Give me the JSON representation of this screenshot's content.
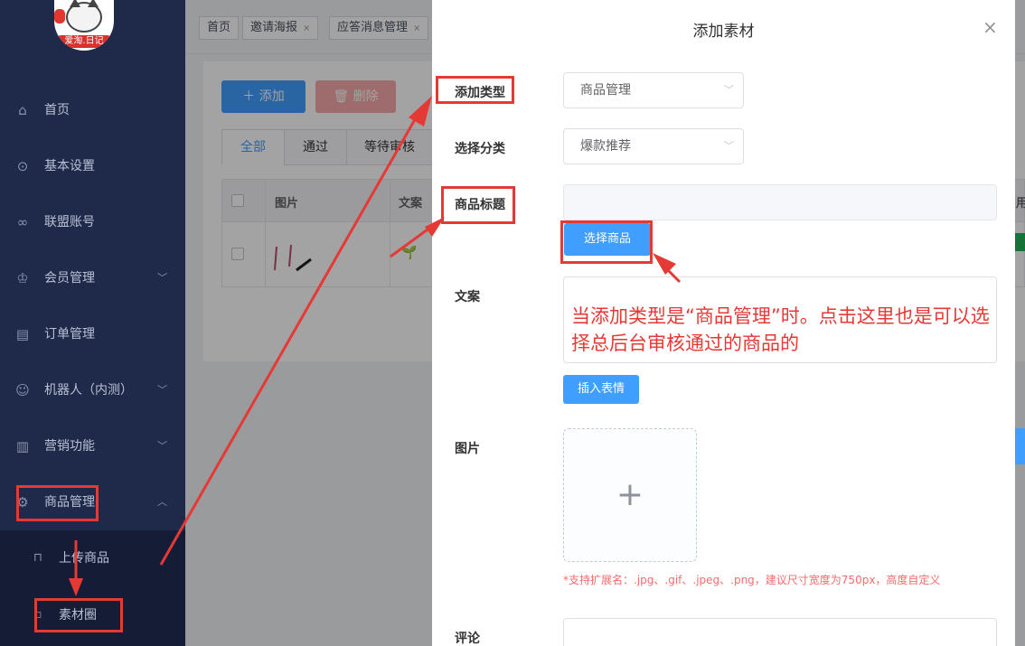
{
  "sidebar": {
    "logo_text": "爱淘.日记",
    "items": [
      {
        "label": "首页",
        "icon": "home-icon"
      },
      {
        "label": "基本设置",
        "icon": "settings-icon"
      },
      {
        "label": "联盟账号",
        "icon": "link-icon"
      },
      {
        "label": "会员管理",
        "icon": "crown-icon"
      },
      {
        "label": "订单管理",
        "icon": "order-icon"
      },
      {
        "label": "机器人（内测）",
        "icon": "robot-icon"
      },
      {
        "label": "营销功能",
        "icon": "bar-chart-icon"
      },
      {
        "label": "商品管理",
        "icon": "goods-icon"
      }
    ],
    "sub_items": [
      {
        "label": "上传商品",
        "icon": "bag-icon"
      },
      {
        "label": "素材圈",
        "icon": "doc-icon"
      }
    ]
  },
  "tabs": [
    "首页",
    "邀请海报",
    "应答消息管理"
  ],
  "content": {
    "add_label": "＋ 添加",
    "delete_label": "删除",
    "filter_tabs": [
      "全部",
      "通过",
      "等待审核"
    ],
    "columns": [
      "图片",
      "文案"
    ],
    "right_col_partial": "用"
  },
  "drawer": {
    "title": "添加素材",
    "close": "×",
    "labels": {
      "type": "添加类型",
      "category": "选择分类",
      "goods_title": "商品标题",
      "copy": "文案",
      "image": "图片",
      "comment": "评论"
    },
    "type_value": "商品管理",
    "category_value": "爆款推荐",
    "select_goods_label": "选择商品",
    "insert_emoji_label": "插入表情",
    "upload_plus": "+",
    "hint": "*支持扩展名：.jpg、.gif、.jpeg、.png，建议尺寸宽度为750px，高度自定义"
  },
  "annotation": "当添加类型是“商品管理”时。点击这里也是可以选择总后台审核通过的商品的",
  "colors": {
    "primary": "#409eff",
    "sidebar": "#1f2a4a",
    "annotation_red": "#e53935"
  }
}
